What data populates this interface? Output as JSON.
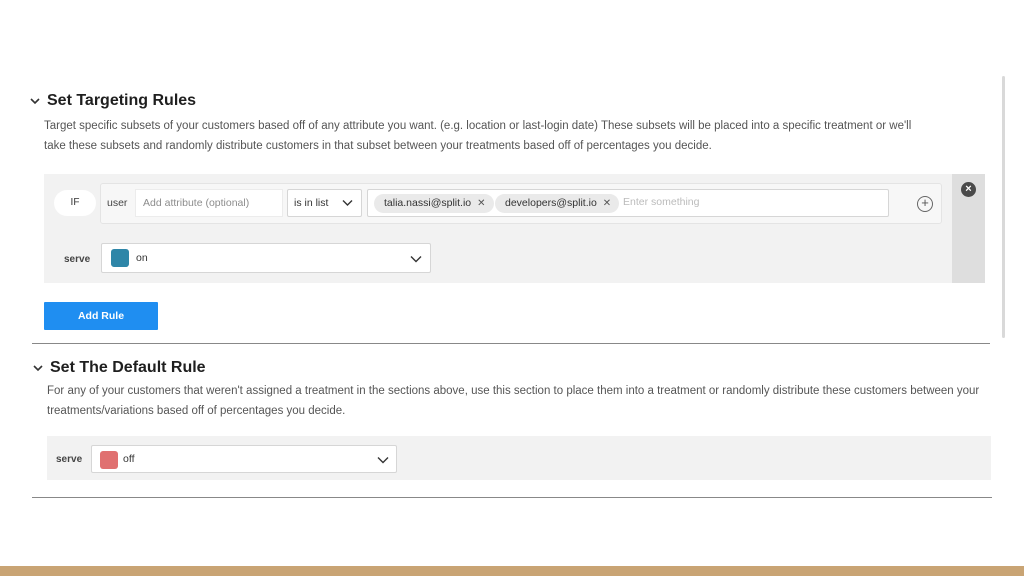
{
  "targeting": {
    "title": "Set Targeting Rules",
    "description_line1": "Target specific subsets of your customers based off of any attribute you want. (e.g. location or last-login date) These subsets will be placed into a specific treatment or we'll",
    "description_line2": "take these subsets and randomly distribute customers in that subset between your treatments based off of percentages you decide.",
    "rule": {
      "if_label": "IF",
      "subject": "user",
      "attribute_placeholder": "Add attribute (optional)",
      "matcher": "is in list",
      "values": [
        "talia.nassi@split.io",
        "developers@split.io"
      ],
      "values_placeholder": "Enter something",
      "serve_label": "serve",
      "serve_value": "on",
      "serve_color": "#2e86a8"
    },
    "add_rule_label": "Add Rule"
  },
  "default_rule": {
    "title": "Set The Default Rule",
    "description_line1": "For any of your customers that weren't assigned a treatment in the sections above, use this section to place them into a treatment or randomly distribute these customers between your",
    "description_line2": "treatments/variations based off of percentages you decide.",
    "serve_label": "serve",
    "serve_value": "off",
    "serve_color": "#e07070"
  },
  "colors": {
    "primary_button": "#1f8ef1",
    "bottom_bar": "#c9a474"
  }
}
